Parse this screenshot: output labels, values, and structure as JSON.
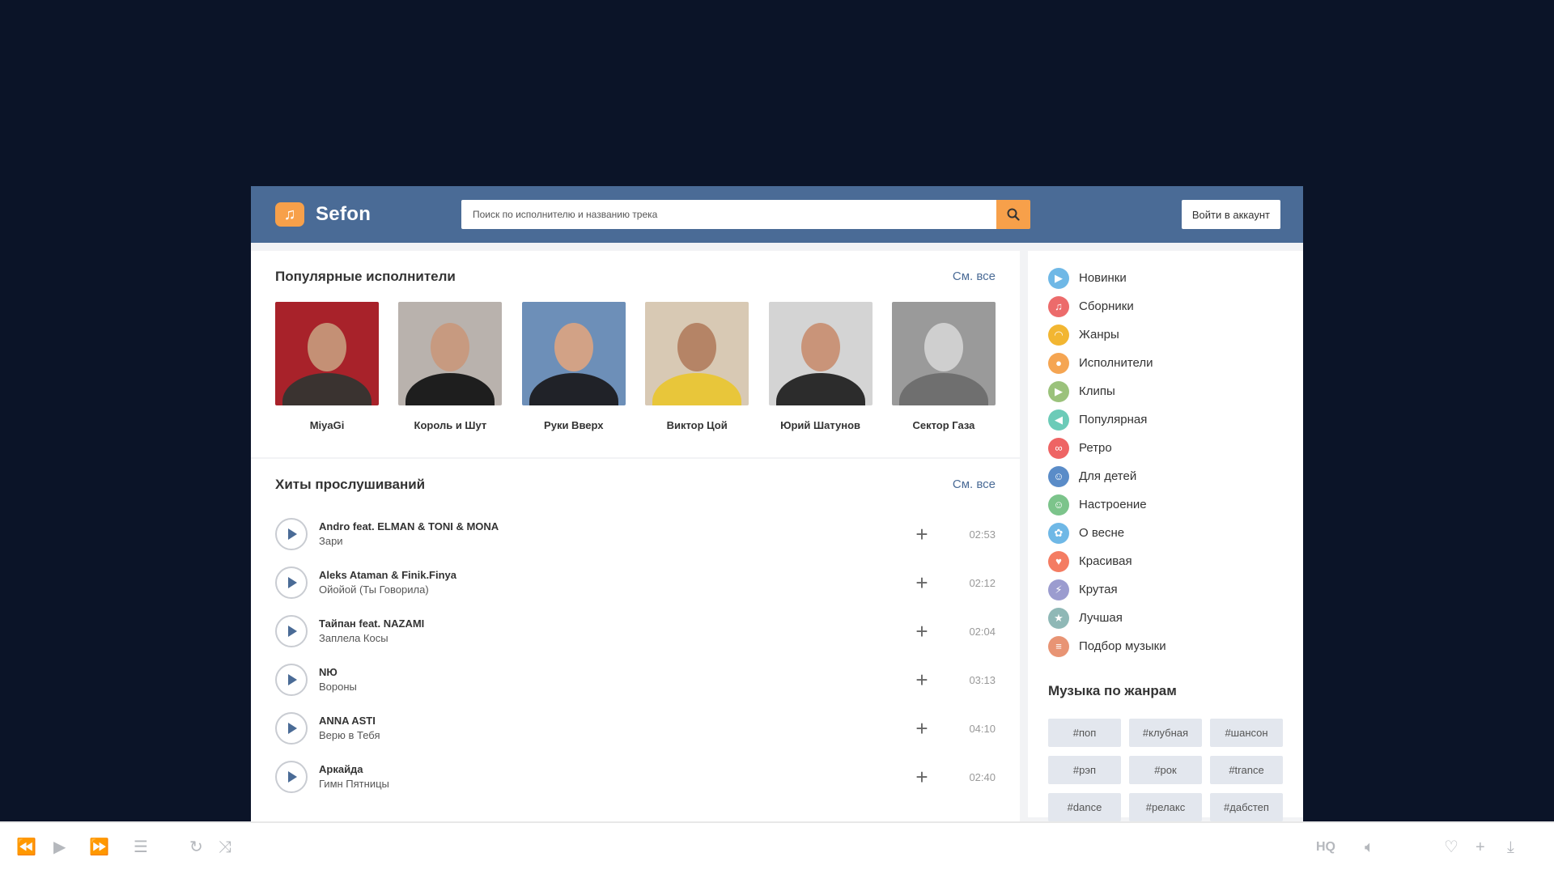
{
  "header": {
    "logo_glyph": "♫",
    "logo_text": "Sefon",
    "search_placeholder": "Поиск по исполнителю и названию трека",
    "login_label": "Войти в аккаунт"
  },
  "artists_section": {
    "title": "Популярные исполнители",
    "see_all": "См. все",
    "items": [
      {
        "name": "MiyaGi"
      },
      {
        "name": "Король и Шут"
      },
      {
        "name": "Руки Вверх"
      },
      {
        "name": "Виктор Цой"
      },
      {
        "name": "Юрий Шатунов"
      },
      {
        "name": "Сектор Газа"
      }
    ]
  },
  "hits_section": {
    "title": "Хиты прослушиваний",
    "see_all": "См. все",
    "tracks": [
      {
        "artist": "Andro feat. ELMAN & TONI & MONA",
        "title": "Зари",
        "duration": "02:53"
      },
      {
        "artist": "Aleks Ataman & Finik.Finya",
        "title": "Ойойой (Ты Говорила)",
        "duration": "02:12"
      },
      {
        "artist": "Тайпан feat. NAZAMI",
        "title": "Заплела Косы",
        "duration": "02:04"
      },
      {
        "artist": "NЮ",
        "title": "Вороны",
        "duration": "03:13"
      },
      {
        "artist": "ANNA ASTI",
        "title": "Верю в Тебя",
        "duration": "04:10"
      },
      {
        "artist": "Аркайда",
        "title": "Гимн Пятницы",
        "duration": "02:40"
      }
    ]
  },
  "sidebar": {
    "menu": [
      {
        "label": "Новинки",
        "icon": "play-icon",
        "glyph": "▶",
        "color": "#6fb8e6"
      },
      {
        "label": "Сборники",
        "icon": "music-note-icon",
        "glyph": "♫",
        "color": "#ec6b6b"
      },
      {
        "label": "Жанры",
        "icon": "headphones-icon",
        "glyph": "◠",
        "color": "#f2b632"
      },
      {
        "label": "Исполнители",
        "icon": "microphone-icon",
        "glyph": "●",
        "color": "#f5a552"
      },
      {
        "label": "Клипы",
        "icon": "video-icon",
        "glyph": "▶",
        "color": "#9bc27b"
      },
      {
        "label": "Популярная",
        "icon": "speaker-icon",
        "glyph": "◀",
        "color": "#6ccbb8"
      },
      {
        "label": "Ретро",
        "icon": "cassette-icon",
        "glyph": "∞",
        "color": "#ee6464"
      },
      {
        "label": "Для детей",
        "icon": "child-icon",
        "glyph": "☺",
        "color": "#5a8cc8"
      },
      {
        "label": "Настроение",
        "icon": "smile-icon",
        "glyph": "☺",
        "color": "#7cc48b"
      },
      {
        "label": "О весне",
        "icon": "bird-icon",
        "glyph": "✿",
        "color": "#6fb8e6"
      },
      {
        "label": "Красивая",
        "icon": "heart-icon",
        "glyph": "♥",
        "color": "#f47c62"
      },
      {
        "label": "Крутая",
        "icon": "lightning-icon",
        "glyph": "⚡",
        "color": "#9b9ccf"
      },
      {
        "label": "Лучшая",
        "icon": "award-icon",
        "glyph": "★",
        "color": "#8fb8b6"
      },
      {
        "label": "Подбор музыки",
        "icon": "equalizer-icon",
        "glyph": "≡",
        "color": "#e89474"
      }
    ],
    "genres_title": "Музыка по жанрам",
    "tags": [
      "#поп",
      "#клубная",
      "#шансон",
      "#рэп",
      "#рок",
      "#trance",
      "#dance",
      "#релакс",
      "#дабстеп"
    ]
  },
  "player": {
    "hq_label": "HQ",
    "icons": [
      "rewind-icon",
      "play-icon",
      "fast-forward-icon",
      "playlist-icon",
      "repeat-icon",
      "shuffle-icon",
      "volume-icon",
      "heart-icon",
      "add-icon",
      "download-icon"
    ]
  },
  "colors": {
    "background": "#0b1428",
    "header": "#4a6b96",
    "accent": "#f7a04a"
  }
}
